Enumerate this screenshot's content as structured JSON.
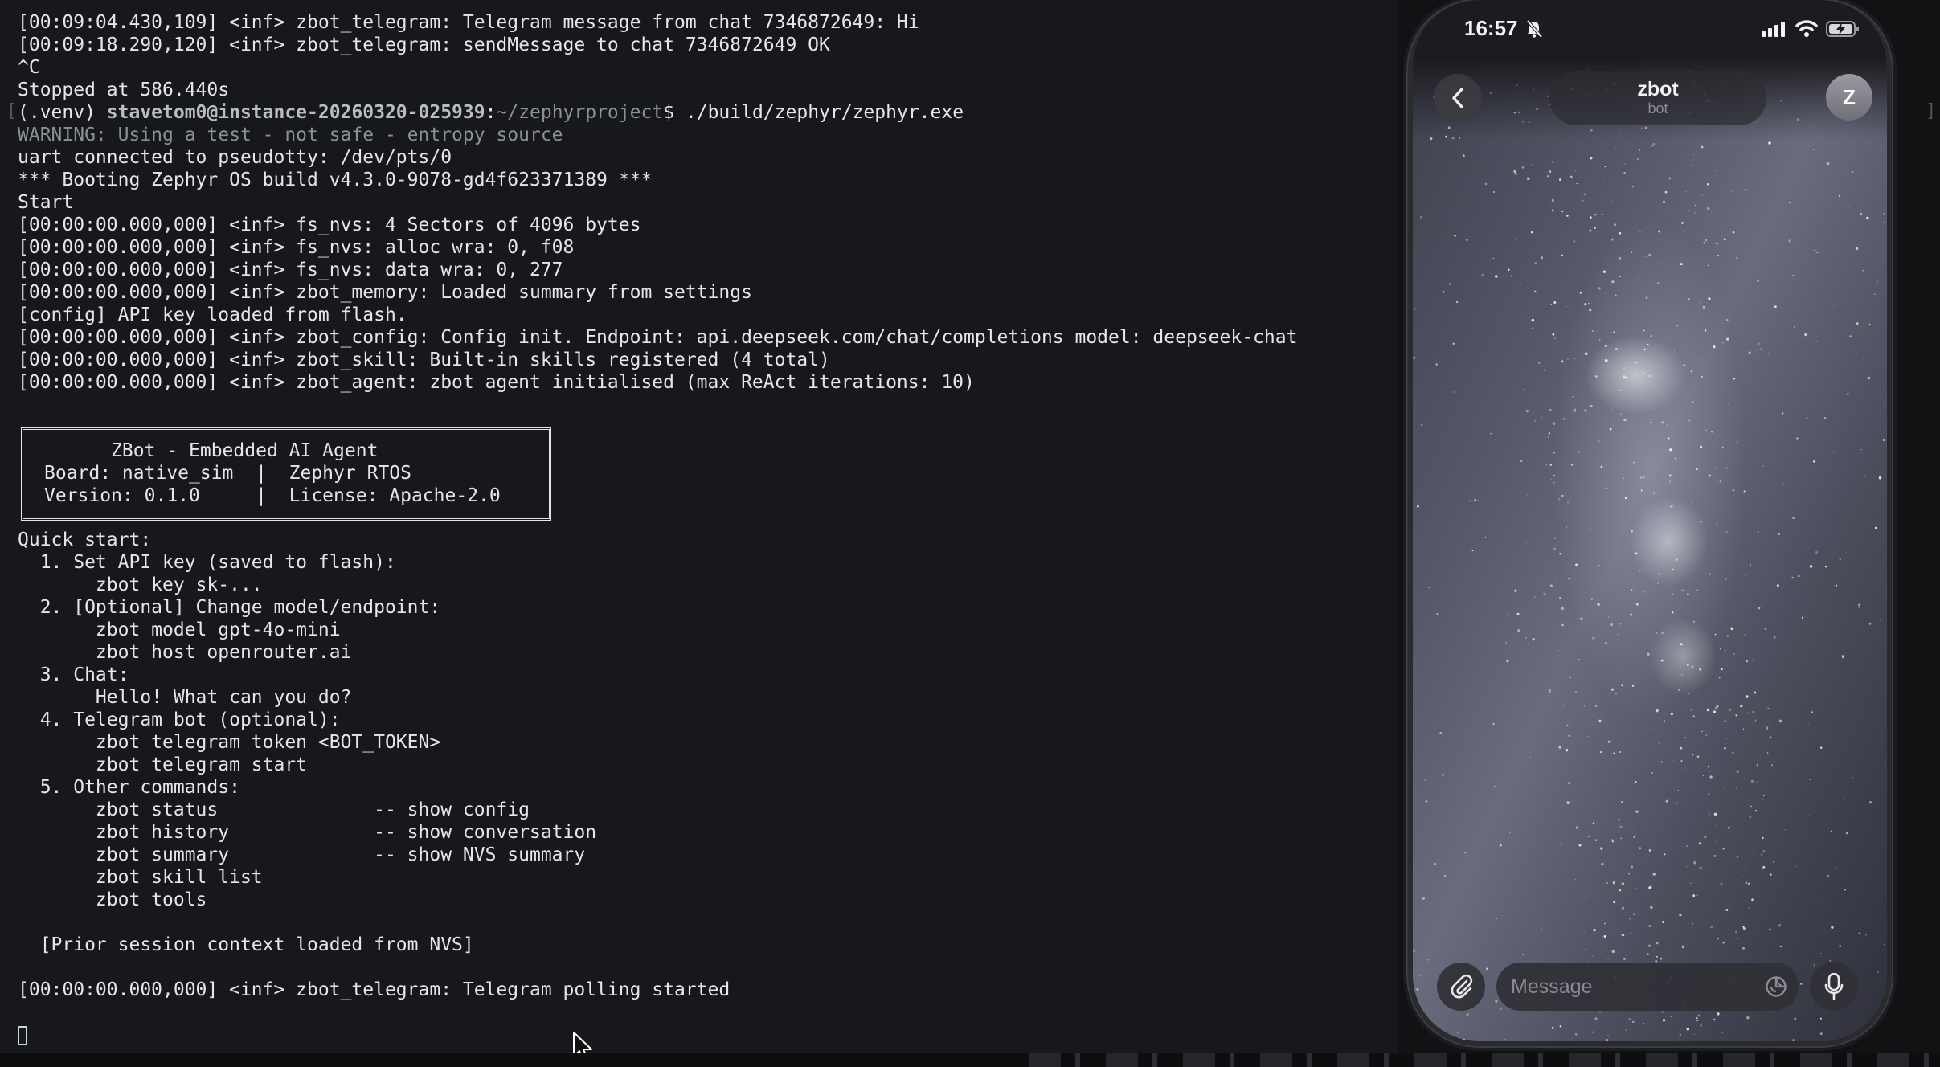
{
  "terminal": {
    "lines": [
      {
        "text": "[00:09:04.430,109] <inf> zbot_telegram: Telegram message from chat 7346872649: Hi"
      },
      {
        "text": "[00:09:18.290,120] <inf> zbot_telegram: sendMessage to chat 7346872649 OK"
      },
      {
        "text": "^C"
      },
      {
        "text": "Stopped at 586.440s"
      },
      {
        "prefix": "(.venv) ",
        "user_host": "stavetom0@instance-20260320-025939",
        "sep": ":",
        "path": "~/zephyrproject",
        "prompt": "$ ",
        "command": "./build/zephyr/zephyr.exe"
      },
      {
        "text": "WARNING: Using a test - not safe - entropy source",
        "style": "dim"
      },
      {
        "text": "uart connected to pseudotty: /dev/pts/0"
      },
      {
        "text": "*** Booting Zephyr OS build v4.3.0-9078-gd4f623371389 ***"
      },
      {
        "text": "Start"
      },
      {
        "text": "[00:00:00.000,000] <inf> fs_nvs: 4 Sectors of 4096 bytes"
      },
      {
        "text": "[00:00:00.000,000] <inf> fs_nvs: alloc wra: 0, f08"
      },
      {
        "text": "[00:00:00.000,000] <inf> fs_nvs: data wra: 0, 277"
      },
      {
        "text": "[00:00:00.000,000] <inf> zbot_memory: Loaded summary from settings"
      },
      {
        "text": "[config] API key loaded from flash."
      },
      {
        "text": "[00:00:00.000,000] <inf> zbot_config: Config init. Endpoint: api.deepseek.com/chat/completions model: deepseek-chat"
      },
      {
        "text": "[00:00:00.000,000] <inf> zbot_skill: Built-in skills registered (4 total)"
      },
      {
        "text": "[00:00:00.000,000] <inf> zbot_agent: zbot agent initialised (max ReAct iterations: 10)"
      },
      {
        "text": ""
      },
      {
        "text": ""
      },
      {
        "text": ""
      },
      {
        "text": ""
      },
      {
        "text": ""
      },
      {
        "text": ""
      },
      {
        "text": "Quick start:"
      },
      {
        "text": "  1. Set API key (saved to flash):"
      },
      {
        "text": "       zbot key sk-..."
      },
      {
        "text": "  2. [Optional] Change model/endpoint:"
      },
      {
        "text": "       zbot model gpt-4o-mini"
      },
      {
        "text": "       zbot host openrouter.ai"
      },
      {
        "text": "  3. Chat:"
      },
      {
        "text": "       Hello! What can you do?"
      },
      {
        "text": "  4. Telegram bot (optional):"
      },
      {
        "text": "       zbot telegram token <BOT_TOKEN>"
      },
      {
        "text": "       zbot telegram start"
      },
      {
        "text": "  5. Other commands:"
      },
      {
        "text": "       zbot status              -- show config"
      },
      {
        "text": "       zbot history             -- show conversation"
      },
      {
        "text": "       zbot summary             -- show NVS summary"
      },
      {
        "text": "       zbot skill list"
      },
      {
        "text": "       zbot tools"
      },
      {
        "text": ""
      },
      {
        "text": "  [Prior session context loaded from NVS]"
      },
      {
        "text": ""
      },
      {
        "text": "[00:00:00.000,000] <inf> zbot_telegram: Telegram polling started"
      }
    ],
    "banner": [
      "      ZBot - Embedded AI Agent",
      "Board: native_sim  |  Zephyr RTOS",
      "Version: 0.1.0     |  License: Apache-2.0"
    ],
    "edge_left": "[",
    "edge_right": "]"
  },
  "phone": {
    "status": {
      "time": "16:57",
      "icons": [
        "bell-slash-icon",
        "signal-icon",
        "wifi-icon",
        "battery-charging-icon"
      ]
    },
    "chat": {
      "title": "zbot",
      "subtitle": "bot",
      "avatar_letter": "Z"
    },
    "input": {
      "placeholder": "Message",
      "icons": [
        "paperclip-icon",
        "sticker-icon",
        "microphone-icon"
      ]
    }
  },
  "colors": {
    "terminal_bg": "#17181b",
    "terminal_fg": "#e6e6e6",
    "dim": "#8b8f96",
    "phone_bar": "#1c1c20"
  }
}
